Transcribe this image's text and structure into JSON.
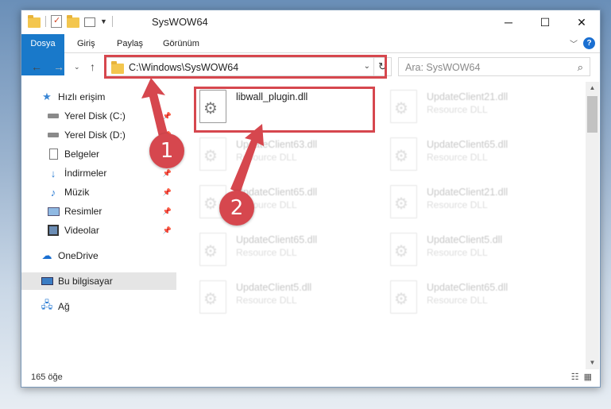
{
  "window": {
    "title": "SysWOW64"
  },
  "ribbon": {
    "tabs": [
      "Dosya",
      "Giriş",
      "Paylaş",
      "Görünüm"
    ],
    "help_label": "?"
  },
  "address": {
    "path": "C:\\Windows\\SysWOW64",
    "search_placeholder": "Ara: SysWOW64"
  },
  "sidebar": {
    "items": [
      {
        "label": "Hızlı erişim",
        "icon": "star-icon"
      },
      {
        "label": "Yerel Disk (C:)",
        "icon": "drive-icon",
        "pinned": true
      },
      {
        "label": "Yerel Disk (D:)",
        "icon": "drive-icon",
        "pinned": true
      },
      {
        "label": "Belgeler",
        "icon": "documents-icon",
        "pinned": true
      },
      {
        "label": "İndirmeler",
        "icon": "downloads-icon",
        "pinned": true
      },
      {
        "label": "Müzik",
        "icon": "music-icon",
        "pinned": true
      },
      {
        "label": "Resimler",
        "icon": "pictures-icon",
        "pinned": true
      },
      {
        "label": "Videolar",
        "icon": "videos-icon",
        "pinned": true
      },
      {
        "label": "OneDrive",
        "icon": "cloud-icon"
      },
      {
        "label": "Bu bilgisayar",
        "icon": "computer-icon",
        "selected": true
      },
      {
        "label": "Ağ",
        "icon": "network-icon"
      }
    ]
  },
  "files": [
    {
      "name": "libwall_plugin.dll",
      "type": ""
    },
    {
      "name": "UpdateClient21.dll",
      "type": "Resource DLL"
    },
    {
      "name": "UpdateClient63.dll",
      "type": "Resource DLL"
    },
    {
      "name": "UpdateClient65.dll",
      "type": "Resource DLL"
    },
    {
      "name": "UpdateClient65.dll",
      "type": "Resource DLL"
    },
    {
      "name": "UpdateClient21.dll",
      "type": "Resource DLL"
    },
    {
      "name": "UpdateClient65.dll",
      "type": "Resource DLL"
    },
    {
      "name": "UpdateClient5.dll",
      "type": "Resource DLL"
    },
    {
      "name": "UpdateClient5.dll",
      "type": "Resource DLL"
    },
    {
      "name": "UpdateClient65.dll",
      "type": "Resource DLL"
    }
  ],
  "status": {
    "count": "165 öğe"
  },
  "annotations": {
    "step1": "1",
    "step2": "2",
    "color": "#d6474e"
  }
}
